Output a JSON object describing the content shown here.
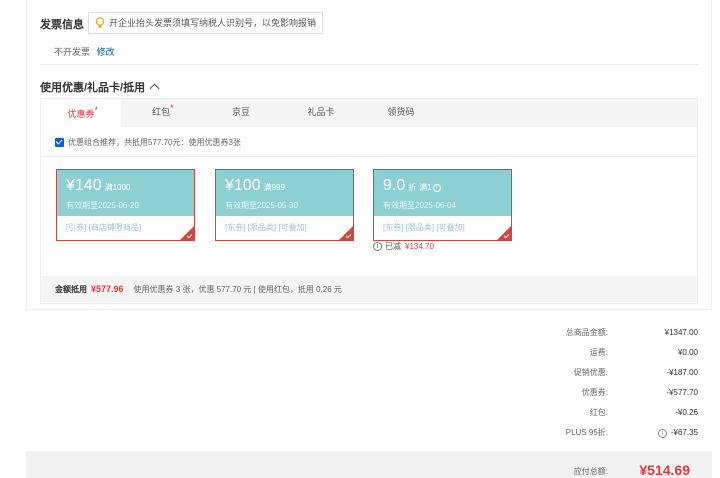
{
  "invoice": {
    "title": "发票信息",
    "tip": "开企业抬头发票须填写纳税人识别号，以免影响报销",
    "status": "不开发票",
    "modify": "修改"
  },
  "discount": {
    "title": "使用优惠/礼品卡/抵用",
    "tabs": [
      {
        "label": "优惠券",
        "star": "*"
      },
      {
        "label": "红包",
        "star": "*"
      },
      {
        "label": "京豆",
        "star": ""
      },
      {
        "label": "礼品卡",
        "star": ""
      },
      {
        "label": "领货码",
        "star": ""
      }
    ],
    "combo_text": "优惠组合推荐，共抵用577.70元：使用优惠券3张",
    "coupons": [
      {
        "amount": "¥140",
        "unit": "",
        "cond": "满1000",
        "valid": "有效期至2025-06-20",
        "tags": "[引券] [商店铺限商品]"
      },
      {
        "amount": "¥100",
        "unit": "",
        "cond": "满999",
        "valid": "有效期至2025-05-30",
        "tags": "[东券] [限品类] [可叠加]"
      },
      {
        "amount": "9.0",
        "unit": "折",
        "cond": "满1",
        "valid": "有效期至2025-06-04",
        "tags": "[东券] [限品类] [可叠加]"
      }
    ],
    "reduced_label": "已减",
    "reduced_amount": "¥134.70",
    "summary": {
      "label": "金额抵用",
      "amount": "¥577.96",
      "detail": "使用优惠券 3 张，优惠 577.70 元  | 使用红包，抵用 0.26 元"
    }
  },
  "totals": [
    {
      "label": "总商品金额:",
      "value": "¥1347.00"
    },
    {
      "label": "运费:",
      "value": "¥0.00"
    },
    {
      "label": "促销优惠:",
      "value": "-¥187.00"
    },
    {
      "label": "优惠券:",
      "value": "-¥577.70"
    },
    {
      "label": "红包:",
      "value": "-¥0.26"
    },
    {
      "label": "PLUS 95折:",
      "value": "-¥67.35"
    }
  ],
  "payable": {
    "label": "应付总额:",
    "value": "¥514.69"
  }
}
